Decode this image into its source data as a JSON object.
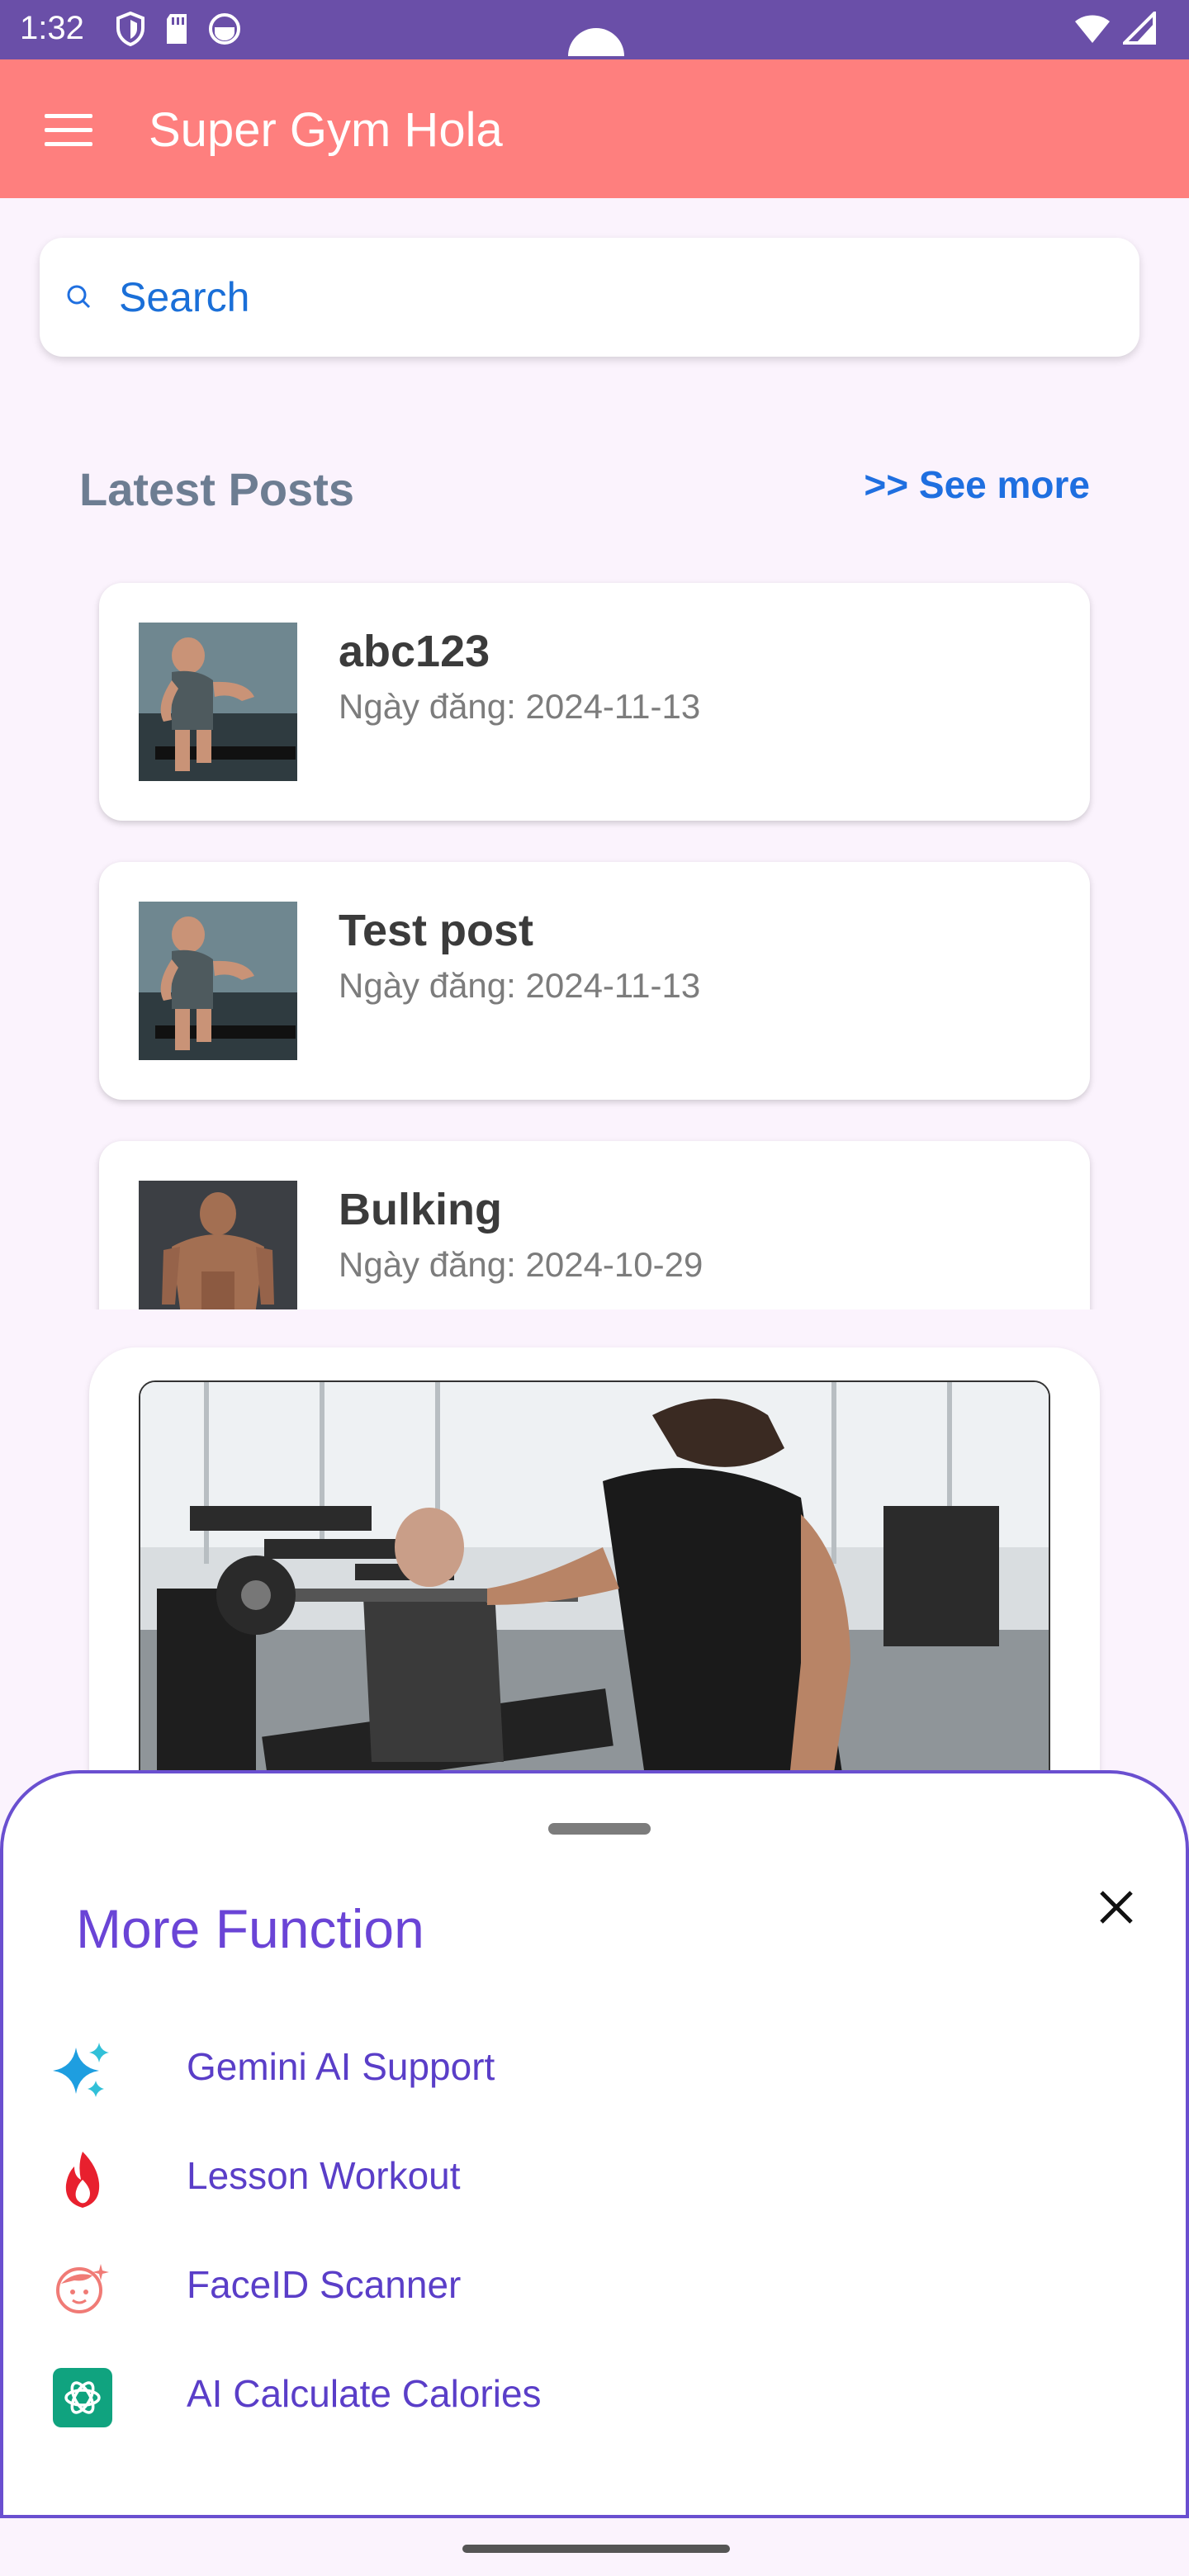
{
  "status_bar": {
    "time": "1:32"
  },
  "app_bar": {
    "title": "Super Gym Hola",
    "menu_icon": "hamburger-icon"
  },
  "search": {
    "placeholder": "Search",
    "icon": "search-icon"
  },
  "latest_posts": {
    "title": "Latest Posts",
    "see_more": ">> See more",
    "items": [
      {
        "title": "abc123",
        "date": "Ngày đăng: 2024-11-13",
        "thumb": "treadmill-runner"
      },
      {
        "title": "Test post",
        "date": "Ngày đăng: 2024-11-13",
        "thumb": "treadmill-runner"
      },
      {
        "title": "Bulking",
        "date": "Ngày đăng: 2024-10-29",
        "thumb": "bodybuilder"
      }
    ]
  },
  "feature": {
    "image": "trainer-assisting-client"
  },
  "bottom_sheet": {
    "title": "More Function",
    "items": [
      {
        "label": "Gemini AI Support",
        "icon": "sparkle-icon"
      },
      {
        "label": "Lesson Workout",
        "icon": "flame-icon"
      },
      {
        "label": "FaceID Scanner",
        "icon": "face-icon"
      },
      {
        "label": "AI Calculate Calories",
        "icon": "openai-icon"
      }
    ]
  },
  "colors": {
    "status_bar": "#6a4fa8",
    "app_bar": "#fe7f7e",
    "accent_blue": "#1f6fe0",
    "sheet_purple": "#6a44d6"
  }
}
